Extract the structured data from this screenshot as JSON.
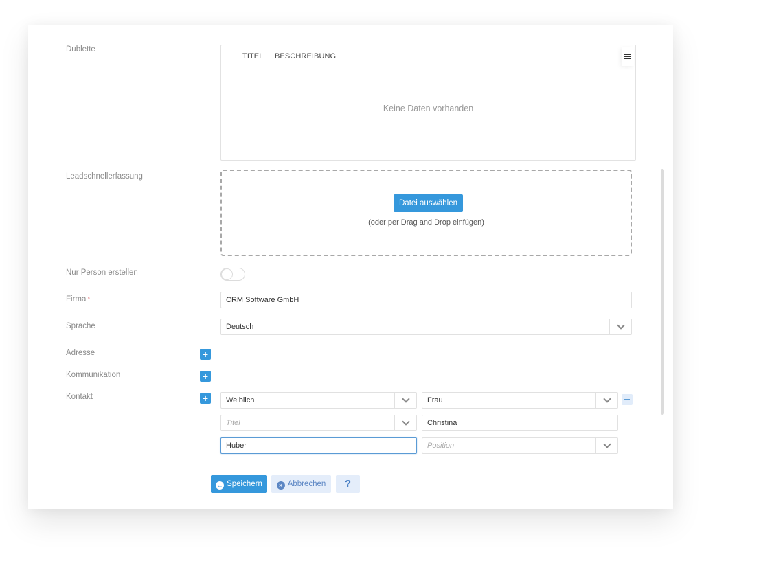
{
  "form": {
    "dublette": {
      "label": "Dublette",
      "columns": [
        "TITEL",
        "BESCHREIBUNG"
      ],
      "empty_text": "Keine Daten vorhanden",
      "menu_icon": "hamburger-menu-icon"
    },
    "leadschnellerfassung": {
      "label": "Leadschnellerfassung",
      "button_label": "Datei auswählen",
      "hint": "(oder per Drag and Drop einfügen)"
    },
    "nur_person": {
      "label": "Nur Person erstellen",
      "enabled": false
    },
    "firma": {
      "label": "Firma",
      "required_mark": "*",
      "value": "CRM Software GmbH"
    },
    "sprache": {
      "label": "Sprache",
      "value": "Deutsch"
    },
    "adresse": {
      "label": "Adresse"
    },
    "kommunikation": {
      "label": "Kommunikation"
    },
    "kontakt": {
      "label": "Kontakt",
      "geschlecht": "Weiblich",
      "anrede": "Frau",
      "titel_placeholder": "Titel",
      "vorname": "Christina",
      "nachname": "Huber",
      "position_placeholder": "Position"
    }
  },
  "actions": {
    "save": "Speichern",
    "cancel": "Abbrechen",
    "help": "?"
  },
  "colors": {
    "primary": "#3598dc",
    "secondary_bg": "#e4edfa",
    "required": "#e0565b"
  }
}
